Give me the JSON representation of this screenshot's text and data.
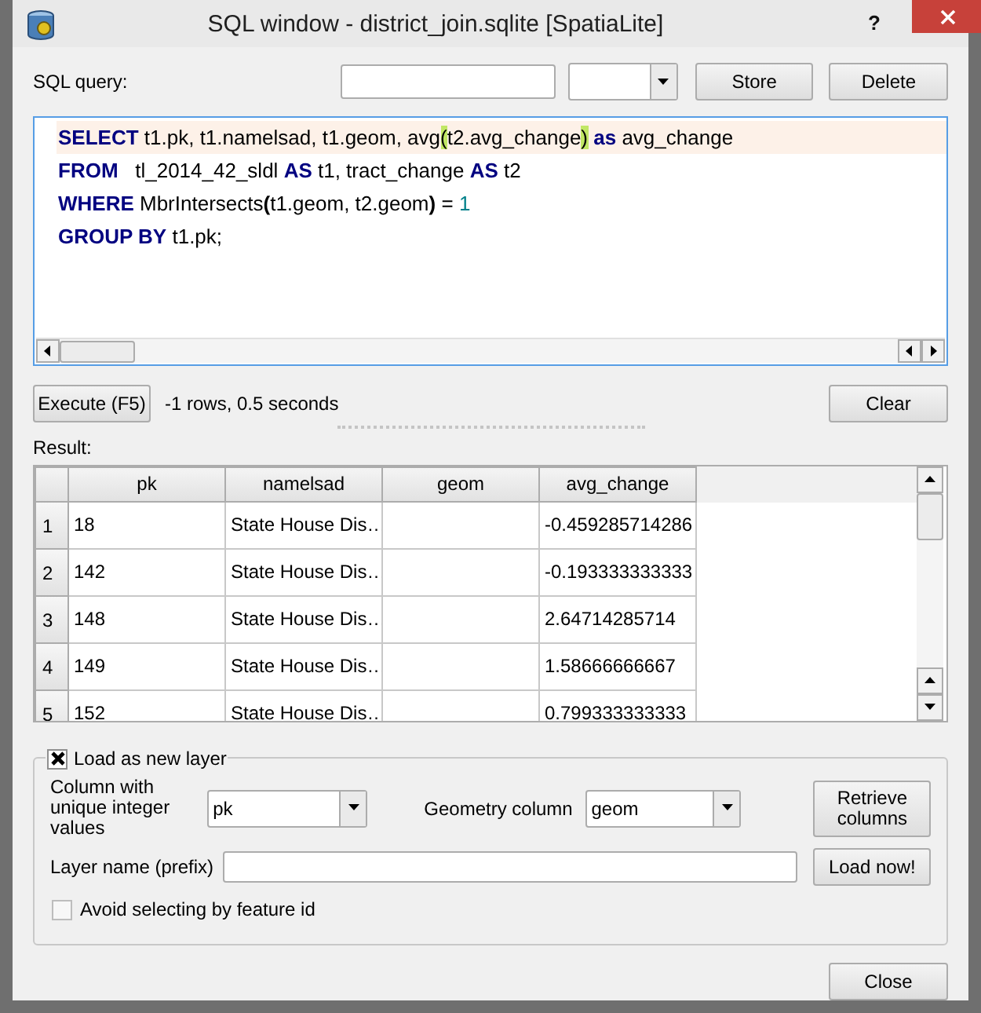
{
  "window": {
    "title": "SQL window - district_join.sqlite [SpatiaLite]",
    "help": "?"
  },
  "query_bar": {
    "label": "SQL query:",
    "buttons": [
      "Store",
      "Delete"
    ]
  },
  "editor": {
    "lines": [
      {
        "current": true,
        "tokens": [
          {
            "kind": "keyword",
            "text": "SELECT"
          },
          {
            "kind": "plain",
            "text": " t1.pk, t1.namelsad, t1.geom, avg"
          },
          {
            "kind": "match",
            "text": "("
          },
          {
            "kind": "plain",
            "text": "t2.avg_change"
          },
          {
            "kind": "match",
            "text": ")"
          },
          {
            "kind": "keyword",
            "text": " as"
          },
          {
            "kind": "plain",
            "text": " avg_change"
          }
        ]
      },
      {
        "current": false,
        "tokens": [
          {
            "kind": "keyword",
            "text": "FROM"
          },
          {
            "kind": "plain",
            "text": "   tl_2014_42_sldl "
          },
          {
            "kind": "keyword",
            "text": "AS"
          },
          {
            "kind": "plain",
            "text": " t1, tract_change "
          },
          {
            "kind": "keyword",
            "text": "AS"
          },
          {
            "kind": "plain",
            "text": " t2"
          }
        ]
      },
      {
        "current": false,
        "tokens": [
          {
            "kind": "keyword",
            "text": "WHERE"
          },
          {
            "kind": "plain",
            "text": " MbrIntersects"
          },
          {
            "kind": "paren",
            "text": "("
          },
          {
            "kind": "plain",
            "text": "t1.geom, t2.geom"
          },
          {
            "kind": "paren",
            "text": ")"
          },
          {
            "kind": "plain",
            "text": " = "
          },
          {
            "kind": "number",
            "text": "1"
          }
        ]
      },
      {
        "current": false,
        "tokens": [
          {
            "kind": "keyword",
            "text": "GROUP BY"
          },
          {
            "kind": "plain",
            "text": " t1.pk;"
          }
        ]
      }
    ]
  },
  "execute": {
    "button": "Execute (F5)",
    "status": "-1 rows, 0.5 seconds",
    "clear": "Clear"
  },
  "result": {
    "label": "Result:",
    "columns": [
      "pk",
      "namelsad",
      "geom",
      "avg_change"
    ],
    "rows": [
      {
        "header": "1",
        "column_1": "18",
        "column_2": "State House Dis…",
        "column_4": "-0.459285714286"
      },
      {
        "header": "2",
        "column_1": "142",
        "column_2": "State House Dis…",
        "column_4": "-0.193333333333"
      },
      {
        "header": "3",
        "column_1": "148",
        "column_2": "State House Dis…",
        "column_4": "2.64714285714"
      },
      {
        "header": "4",
        "column_1": "149",
        "column_2": "State House Dis…",
        "column_4": "1.58666666667"
      },
      {
        "header": "5",
        "column_1": "152",
        "column_2": "State House Dis…",
        "column_4": "0.799333333333"
      }
    ]
  },
  "load_layer": {
    "label": "Load as new layer",
    "checked": true,
    "unique_label": "Column with unique integer values",
    "unique_value": "pk",
    "geometry_label": "Geometry column",
    "geometry_value": "geom",
    "retrieve": "Retrieve columns",
    "layer_name_label": "Layer name (prefix)",
    "load_now": "Load now!",
    "avoid": {
      "label": "Avoid selecting by feature id",
      "checked": false
    }
  },
  "close": "Close"
}
